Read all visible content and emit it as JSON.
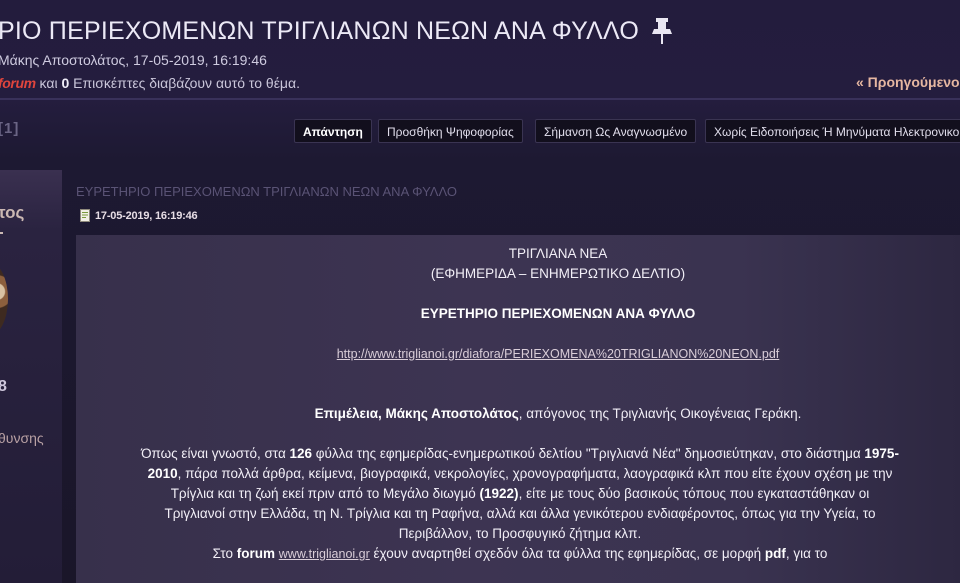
{
  "header": {
    "title": "ΡΙΟ ΠΕΡΙΕΧΟΜΕΝΩΝ ΤΡΙΓΛΙΑΝΩΝ ΝΕΩΝ ΑΝΑ ΦΥΛΛΟ",
    "author_line": "Μάκης Αποστολάτος, 17-05-2019, 16:19:46",
    "viewers_user": "forum",
    "viewers_mid": " και ",
    "viewers_guest_count": "0",
    "viewers_suffix": " Επισκέπτες διαβάζουν αυτό το θέμα.",
    "prev_link": "« Προηγούμενο"
  },
  "actions": {
    "pagination": "[1]",
    "reply": "Απάντηση",
    "add_poll": "Προσθήκη Ψηφοφορίας",
    "mark_unread": "Σήμανση Ως Αναγνωσμένο",
    "notifications": "Χωρίς Ειδοποιήσεις Ή Μηνύματα Ηλεκτρονικού"
  },
  "profile": {
    "name": "τος",
    "rank": "8",
    "location": "θυνσης"
  },
  "post": {
    "subject": "ΕΥΡΕΤΗΡΙΟ ΠΕΡΙΕΧΟΜΕΝΩΝ ΤΡΙΓΛΙΑΝΩΝ ΝΕΩΝ ΑΝΑ ΦΥΛΛΟ",
    "date": "17-05-2019, 16:19:46",
    "heading1": "ΤΡΙΓΛΙΑΝΑ ΝΕΑ",
    "heading2": "(ΕΦΗΜΕΡΙΔΑ – ΕΝΗΜΕΡΩΤΙΚΟ ΔΕΛΤΙΟ)",
    "index_title": "ΕΥΡΕΤΗΡΙΟ ΠΕΡΙΕΧΟΜΕΝΩΝ ΑΝΑ ΦΥΛΛΟ",
    "pdf_url": "http://www.triglianoi.gr/diafora/PERIEXOMENA%20TRIGLIANON%20NEON.pdf",
    "editor_bold": "Επιμέλεια, Μάκης Αποστολάτος",
    "editor_rest": ", απόγονος της Τριγλιανής Οικογένειας Γεράκη.",
    "para_a": "Όπως είναι γνωστό, στα ",
    "para_issues": "126",
    "para_b": " φύλλα της εφημερίδας-ενημερωτικού δελτίου \"Τριγλιανά Νέα\" δημοσιεύτηκαν, στο διάστημα ",
    "para_period": "1975-2010",
    "para_c": ", πάρα πολλά άρθρα, κείμενα, βιογραφικά, νεκρολογίες, χρονογραφήματα, λαογραφικά κλπ που είτε έχουν σχέση με την Τρίγλια και τη ζωή εκεί πριν από το Μεγάλο διωγμό ",
    "para_year": "(1922)",
    "para_d": ", είτε με τους δύο βασικούς τόπους που εγκαταστάθηκαν οι Τριγλιανοί στην Ελλάδα, τη Ν. Τρίγλια και τη Ραφήνα, αλλά και άλλα γενικότερου ενδιαφέροντος, όπως για την Υγεία, το Περιβάλλον, το Προσφυγικό ζήτημα κλπ.",
    "last_a": "Στο ",
    "last_forum": "forum",
    "last_site": "www.triglianoi.gr",
    "last_b": " έχουν αναρτηθεί σχεδόν όλα τα φύλλα της εφημερίδας, σε μορφή ",
    "last_pdf": "pdf",
    "last_c": ", για το"
  }
}
